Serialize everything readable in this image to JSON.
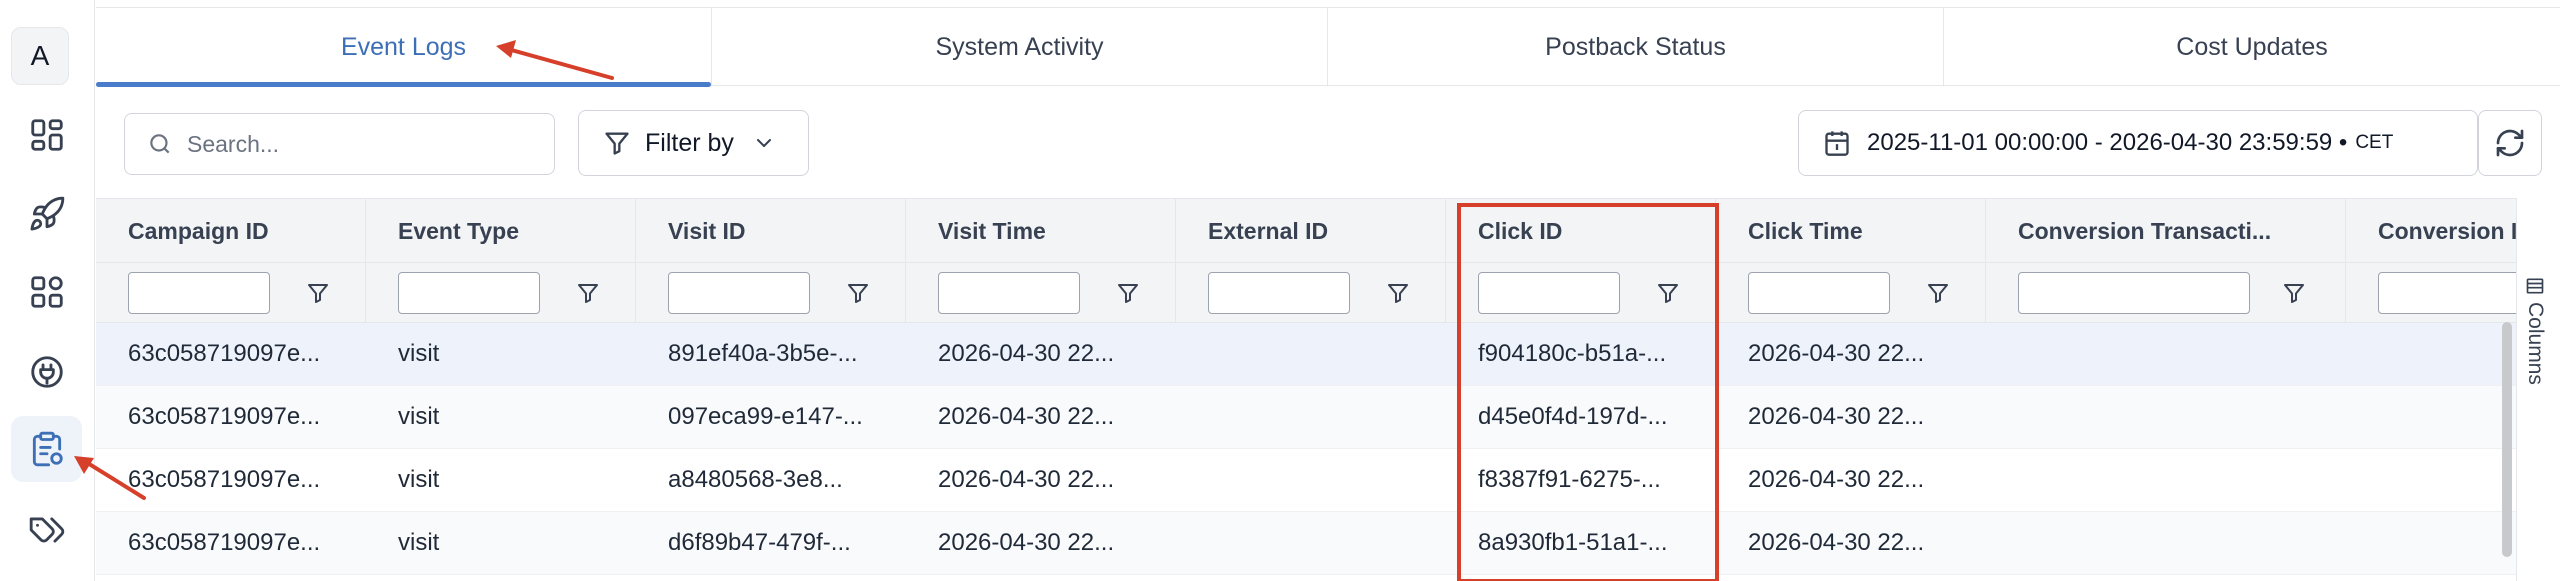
{
  "sidebar": {
    "avatar_letter": "A",
    "items": [
      {
        "name": "dashboard-icon"
      },
      {
        "name": "rocket-icon"
      },
      {
        "name": "apps-grid-icon"
      },
      {
        "name": "plug-icon"
      },
      {
        "name": "clipboard-icon",
        "active": true
      },
      {
        "name": "tags-icon"
      }
    ]
  },
  "tabs": [
    {
      "label": "Event Logs",
      "active": true
    },
    {
      "label": "System Activity"
    },
    {
      "label": "Postback Status"
    },
    {
      "label": "Cost Updates"
    }
  ],
  "toolbar": {
    "search_placeholder": "Search...",
    "filter_label": "Filter by",
    "date_range": "2025-11-01 00:00:00 - 2026-04-30 23:59:59 •",
    "timezone": "CET"
  },
  "table": {
    "columns": [
      "Campaign ID",
      "Event Type",
      "Visit ID",
      "Visit Time",
      "External ID",
      "Click ID",
      "Click Time",
      "Conversion Transacti...",
      "Conversion I"
    ],
    "rows": [
      [
        "63c058719097e...",
        "visit",
        "891ef40a-3b5e-...",
        "2026-04-30 22...",
        "",
        "f904180c-b51a-...",
        "2026-04-30 22...",
        "",
        ""
      ],
      [
        "63c058719097e...",
        "visit",
        "097eca99-e147-...",
        "2026-04-30 22...",
        "",
        "d45e0f4d-197d-...",
        "2026-04-30 22...",
        "",
        ""
      ],
      [
        "63c058719097e...",
        "visit",
        "a8480568-3e8...",
        "2026-04-30 22...",
        "",
        "f8387f91-6275-...",
        "2026-04-30 22...",
        "",
        ""
      ],
      [
        "63c058719097e...",
        "visit",
        "d6f89b47-479f-...",
        "2026-04-30 22...",
        "",
        "8a930fb1-51a1-...",
        "2026-04-30 22...",
        "",
        ""
      ]
    ]
  },
  "side_panel": {
    "label": "Columns"
  },
  "colors": {
    "accent": "#3d6fb6",
    "annotation": "#d6402a"
  }
}
